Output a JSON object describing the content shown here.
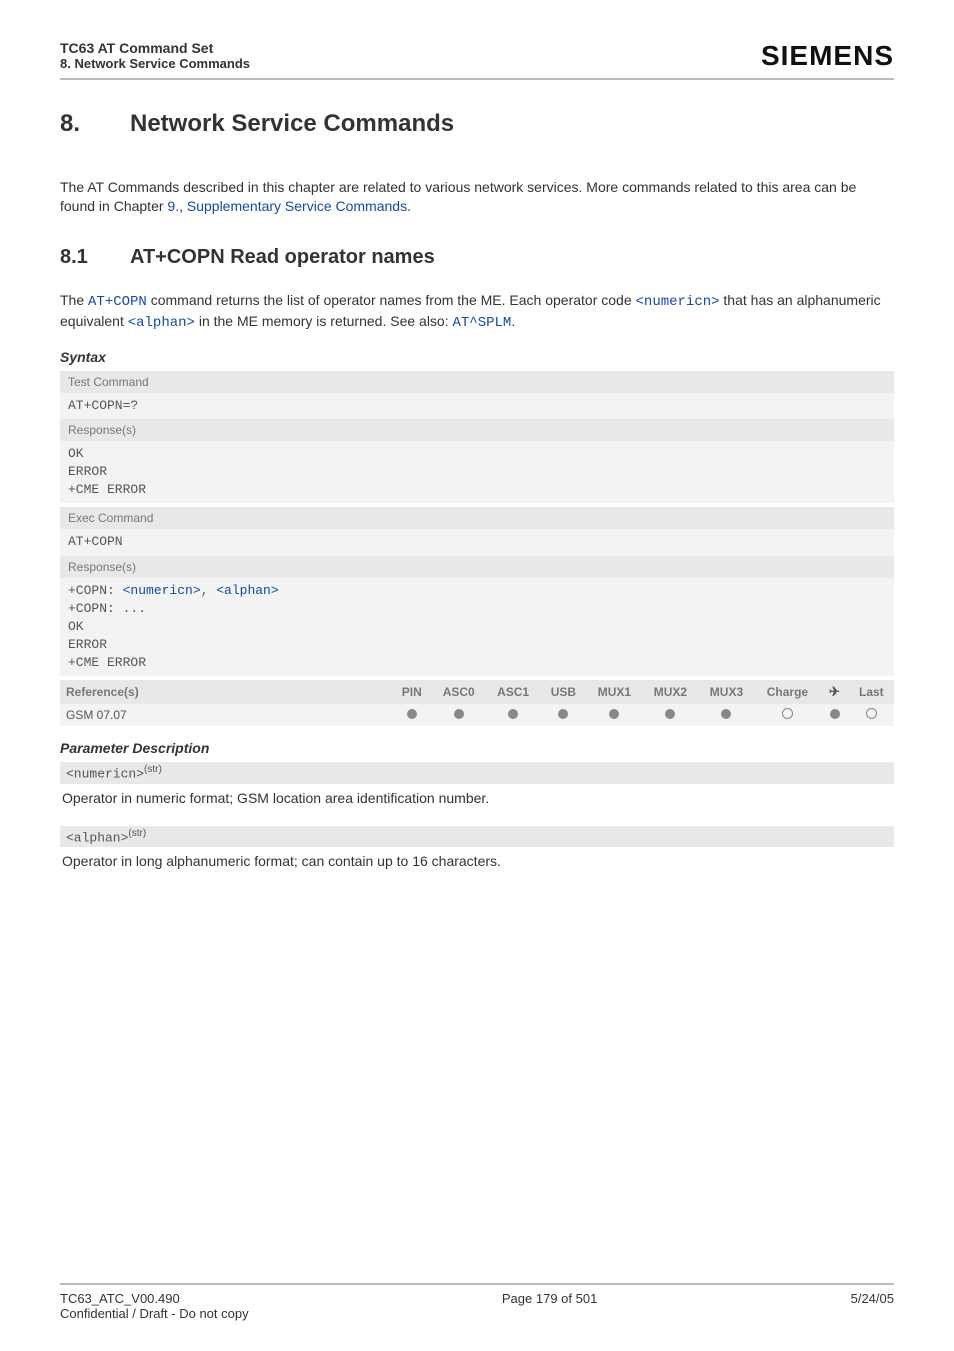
{
  "header": {
    "title": "TC63 AT Command Set",
    "subtitle": "8. Network Service Commands",
    "logo": "SIEMENS"
  },
  "chapter": {
    "num": "8.",
    "title": "Network Service Commands"
  },
  "intro": {
    "pre": "The AT Commands described in this chapter are related to various network services. More commands related to this area can be found in Chapter ",
    "link1": "9.",
    "mid": ", ",
    "link2": "Supplementary Service Commands",
    "post": "."
  },
  "section": {
    "num": "8.1",
    "title": "AT+COPN   Read operator names"
  },
  "para1": {
    "t1": "The ",
    "cmd": "AT+COPN",
    "t2": " command returns the list of operator names from the ME. Each operator code ",
    "p1": "<numericn>",
    "t3": " that has an alphanumeric equivalent ",
    "p2": "<alphan>",
    "t4": " in the ME memory is returned. See also: ",
    "seealso": "AT^SPLM",
    "t5": "."
  },
  "labels": {
    "syntax": "Syntax",
    "test_command": "Test Command",
    "exec_command": "Exec Command",
    "response": "Response(s)",
    "references": "Reference(s)",
    "param_desc": "Parameter Description"
  },
  "syntax": {
    "test_cmd": "AT+COPN=?",
    "test_resp_ok": "OK",
    "test_resp_err": "ERROR",
    "test_resp_cme": "+CME ERROR",
    "exec_cmd": "AT+COPN",
    "exec_line1_pre": "+COPN: ",
    "exec_line1_p1": "<numericn>",
    "exec_line1_sep": ", ",
    "exec_line1_p2": "<alphan>",
    "exec_line2": "+COPN: ...",
    "exec_ok": "OK",
    "exec_err": "ERROR",
    "exec_cme": "+CME ERROR"
  },
  "ref": {
    "value": "GSM 07.07",
    "cols": [
      "PIN",
      "ASC0",
      "ASC1",
      "USB",
      "MUX1",
      "MUX2",
      "MUX3",
      "Charge",
      "✈",
      "Last"
    ],
    "dots": [
      "filled",
      "filled",
      "filled",
      "filled",
      "filled",
      "filled",
      "filled",
      "empty",
      "filled",
      "empty"
    ]
  },
  "params": [
    {
      "name": "<numericn>",
      "sup": "(str)",
      "desc": "Operator in numeric format; GSM location area identification number."
    },
    {
      "name": "<alphan>",
      "sup": "(str)",
      "desc": "Operator in long alphanumeric format; can contain up to 16 characters."
    }
  ],
  "footer": {
    "left1": "TC63_ATC_V00.490",
    "left2": "Confidential / Draft - Do not copy",
    "center": "Page 179 of 501",
    "right": "5/24/05"
  }
}
